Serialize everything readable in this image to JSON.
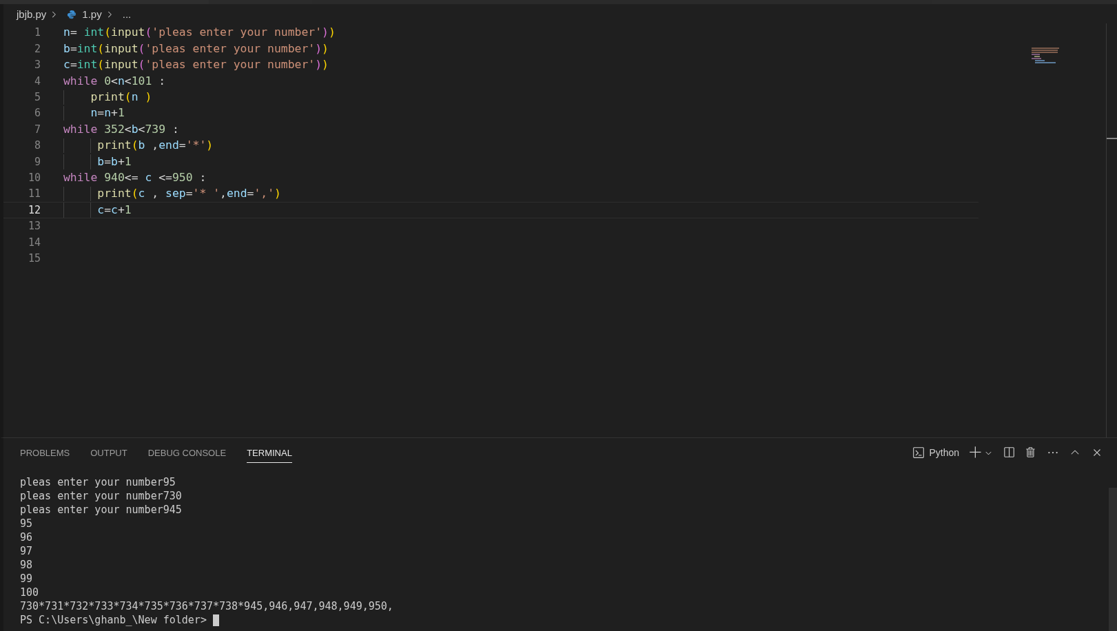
{
  "breadcrumb": {
    "items": [
      {
        "kind": "folder",
        "label": "jbjb.py"
      },
      {
        "kind": "python-file",
        "label": "1.py"
      },
      {
        "kind": "more",
        "label": "..."
      }
    ]
  },
  "editor": {
    "lines": [
      {
        "number": "1",
        "selected": false,
        "tokens": [
          {
            "kind": "variable",
            "text": "n"
          },
          {
            "kind": "operator",
            "text": "= "
          },
          {
            "kind": "type",
            "text": "int"
          },
          {
            "kind": "bracket1",
            "text": "("
          },
          {
            "kind": "function",
            "text": "input"
          },
          {
            "kind": "bracket2",
            "text": "("
          },
          {
            "kind": "string",
            "text": "'pleas enter your number'"
          },
          {
            "kind": "bracket2",
            "text": ")"
          },
          {
            "kind": "bracket1",
            "text": ")"
          }
        ]
      },
      {
        "number": "2",
        "selected": false,
        "tokens": [
          {
            "kind": "variable",
            "text": "b"
          },
          {
            "kind": "operator",
            "text": "="
          },
          {
            "kind": "type",
            "text": "int"
          },
          {
            "kind": "bracket1",
            "text": "("
          },
          {
            "kind": "function",
            "text": "input"
          },
          {
            "kind": "bracket2",
            "text": "("
          },
          {
            "kind": "string",
            "text": "'pleas enter your number'"
          },
          {
            "kind": "bracket2",
            "text": ")"
          },
          {
            "kind": "bracket1",
            "text": ")"
          }
        ]
      },
      {
        "number": "3",
        "selected": false,
        "tokens": [
          {
            "kind": "variable",
            "text": "c"
          },
          {
            "kind": "operator",
            "text": "="
          },
          {
            "kind": "type",
            "text": "int"
          },
          {
            "kind": "bracket1",
            "text": "("
          },
          {
            "kind": "function",
            "text": "input"
          },
          {
            "kind": "bracket2",
            "text": "("
          },
          {
            "kind": "string",
            "text": "'pleas enter your number'"
          },
          {
            "kind": "bracket2",
            "text": ")"
          },
          {
            "kind": "bracket1",
            "text": ")"
          }
        ]
      },
      {
        "number": "4",
        "selected": false,
        "tokens": [
          {
            "kind": "keyword",
            "text": "while"
          },
          {
            "kind": "number",
            "text": " 0"
          },
          {
            "kind": "operator",
            "text": "<"
          },
          {
            "kind": "variable",
            "text": "n"
          },
          {
            "kind": "operator",
            "text": "<"
          },
          {
            "kind": "number",
            "text": "101"
          },
          {
            "kind": "operator",
            "text": " :"
          }
        ]
      },
      {
        "number": "5",
        "selected": false,
        "tokens": [
          {
            "kind": "function",
            "text": "    print"
          },
          {
            "kind": "bracket1",
            "text": "("
          },
          {
            "kind": "variable",
            "text": "n "
          },
          {
            "kind": "bracket1",
            "text": ")"
          }
        ]
      },
      {
        "number": "6",
        "selected": false,
        "tokens": [
          {
            "kind": "variable",
            "text": "    n"
          },
          {
            "kind": "operator",
            "text": "="
          },
          {
            "kind": "variable",
            "text": "n"
          },
          {
            "kind": "operator",
            "text": "+"
          },
          {
            "kind": "number",
            "text": "1"
          }
        ]
      },
      {
        "number": "7",
        "selected": false,
        "tokens": [
          {
            "kind": "keyword",
            "text": "while"
          },
          {
            "kind": "number",
            "text": " 352"
          },
          {
            "kind": "operator",
            "text": "<"
          },
          {
            "kind": "variable",
            "text": "b"
          },
          {
            "kind": "operator",
            "text": "<"
          },
          {
            "kind": "number",
            "text": "739"
          },
          {
            "kind": "operator",
            "text": " :"
          }
        ]
      },
      {
        "number": "8",
        "selected": false,
        "tokens": [
          {
            "kind": "function",
            "text": "     print"
          },
          {
            "kind": "bracket1",
            "text": "("
          },
          {
            "kind": "variable",
            "text": "b "
          },
          {
            "kind": "operator",
            "text": ","
          },
          {
            "kind": "variable",
            "text": "end"
          },
          {
            "kind": "operator",
            "text": "="
          },
          {
            "kind": "string",
            "text": "'*'"
          },
          {
            "kind": "bracket1",
            "text": ")"
          }
        ]
      },
      {
        "number": "9",
        "selected": false,
        "tokens": [
          {
            "kind": "variable",
            "text": "     b"
          },
          {
            "kind": "operator",
            "text": "="
          },
          {
            "kind": "variable",
            "text": "b"
          },
          {
            "kind": "operator",
            "text": "+"
          },
          {
            "kind": "number",
            "text": "1"
          }
        ]
      },
      {
        "number": "10",
        "selected": false,
        "tokens": [
          {
            "kind": "keyword",
            "text": "while"
          },
          {
            "kind": "number",
            "text": " 940"
          },
          {
            "kind": "operator",
            "text": "<= "
          },
          {
            "kind": "variable",
            "text": "c"
          },
          {
            "kind": "operator",
            "text": " <="
          },
          {
            "kind": "number",
            "text": "950"
          },
          {
            "kind": "operator",
            "text": " :"
          }
        ]
      },
      {
        "number": "11",
        "selected": false,
        "tokens": [
          {
            "kind": "function",
            "text": "     print"
          },
          {
            "kind": "bracket1",
            "text": "("
          },
          {
            "kind": "variable",
            "text": "c "
          },
          {
            "kind": "operator",
            "text": ", "
          },
          {
            "kind": "variable",
            "text": "sep"
          },
          {
            "kind": "operator",
            "text": "="
          },
          {
            "kind": "string",
            "text": "'* '"
          },
          {
            "kind": "operator",
            "text": ","
          },
          {
            "kind": "variable",
            "text": "end"
          },
          {
            "kind": "operator",
            "text": "="
          },
          {
            "kind": "string",
            "text": "','"
          },
          {
            "kind": "bracket1",
            "text": ")"
          }
        ]
      },
      {
        "number": "12",
        "selected": true,
        "tokens": [
          {
            "kind": "variable",
            "text": "     c"
          },
          {
            "kind": "operator",
            "text": "="
          },
          {
            "kind": "variable",
            "text": "c"
          },
          {
            "kind": "operator",
            "text": "+"
          },
          {
            "kind": "number",
            "text": "1"
          }
        ]
      },
      {
        "number": "13",
        "selected": false
      },
      {
        "number": "14",
        "selected": false
      },
      {
        "number": "15",
        "selected": false
      }
    ]
  },
  "panel": {
    "tabs": [
      {
        "label": "PROBLEMS",
        "selected": false
      },
      {
        "label": "OUTPUT",
        "selected": false
      },
      {
        "label": "DEBUG CONSOLE",
        "selected": false
      },
      {
        "label": "TERMINAL",
        "selected": true
      }
    ],
    "terminal_name": "Python",
    "terminal_lines": [
      "pleas enter your number95",
      "pleas enter your number730",
      "pleas enter your number945",
      "95",
      "96",
      "97",
      "98",
      "99",
      "100",
      "730*731*732*733*734*735*736*737*738*945,946,947,948,949,950,",
      "PS C:\\Users\\ghanb_\\New folder>"
    ]
  }
}
